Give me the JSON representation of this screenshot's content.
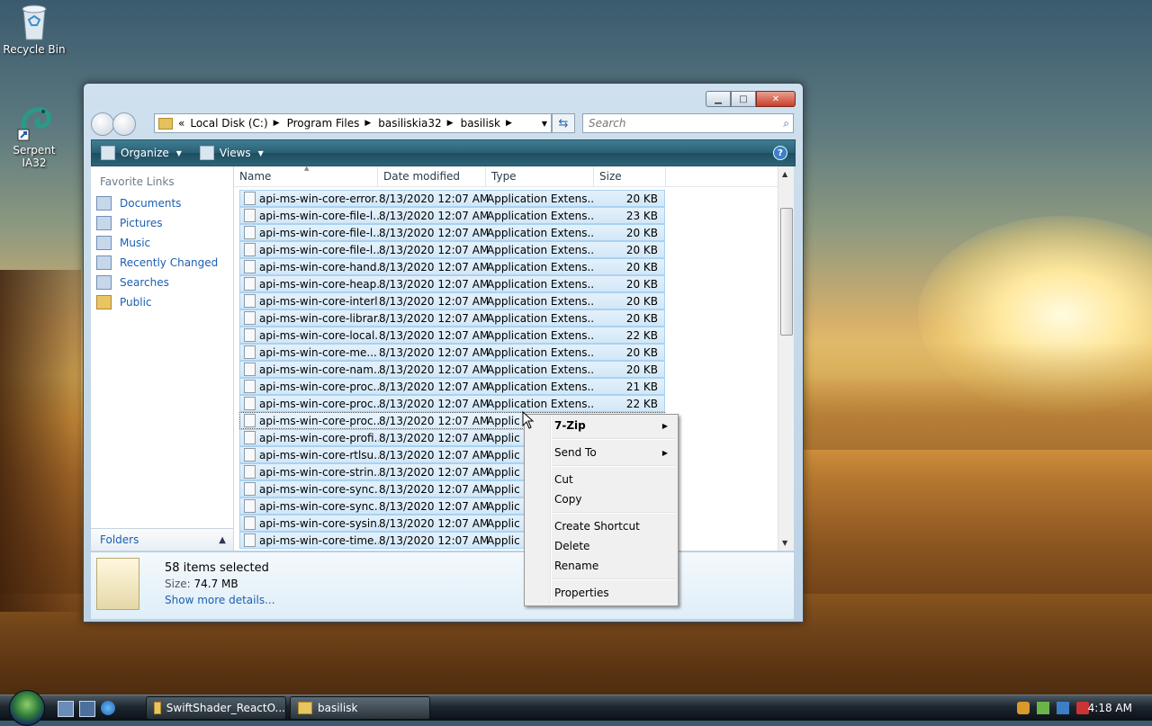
{
  "desktop": {
    "icons": [
      {
        "label": "Recycle Bin"
      },
      {
        "label": "Serpent IA32"
      }
    ]
  },
  "window": {
    "caption": {
      "minimize": "",
      "maximize": "",
      "close": ""
    },
    "address": {
      "prefix": "«",
      "crumbs": [
        "Local Disk (C:)",
        "Program Files",
        "basiliskia32",
        "basilisk"
      ]
    },
    "search": {
      "placeholder": "Search"
    },
    "toolbar": {
      "organize": "Organize",
      "views": "Views",
      "help": "?"
    },
    "nav": {
      "favorites_title": "Favorite Links",
      "links": [
        {
          "label": "Documents",
          "icon": "documents-icon"
        },
        {
          "label": "Pictures",
          "icon": "pictures-icon"
        },
        {
          "label": "Music",
          "icon": "music-icon"
        },
        {
          "label": "Recently Changed",
          "icon": "recently-changed-icon"
        },
        {
          "label": "Searches",
          "icon": "searches-icon"
        },
        {
          "label": "Public",
          "icon": "folder-icon"
        }
      ],
      "folders_label": "Folders"
    },
    "columns": {
      "name": "Name",
      "date": "Date modified",
      "type": "Type",
      "size": "Size"
    },
    "files": [
      {
        "name": "api-ms-win-core-error...",
        "date": "8/13/2020 12:07 AM",
        "type": "Application Extens...",
        "size": "20 KB"
      },
      {
        "name": "api-ms-win-core-file-l...",
        "date": "8/13/2020 12:07 AM",
        "type": "Application Extens...",
        "size": "23 KB"
      },
      {
        "name": "api-ms-win-core-file-l...",
        "date": "8/13/2020 12:07 AM",
        "type": "Application Extens...",
        "size": "20 KB"
      },
      {
        "name": "api-ms-win-core-file-l...",
        "date": "8/13/2020 12:07 AM",
        "type": "Application Extens...",
        "size": "20 KB"
      },
      {
        "name": "api-ms-win-core-hand...",
        "date": "8/13/2020 12:07 AM",
        "type": "Application Extens...",
        "size": "20 KB"
      },
      {
        "name": "api-ms-win-core-heap...",
        "date": "8/13/2020 12:07 AM",
        "type": "Application Extens...",
        "size": "20 KB"
      },
      {
        "name": "api-ms-win-core-interl...",
        "date": "8/13/2020 12:07 AM",
        "type": "Application Extens...",
        "size": "20 KB"
      },
      {
        "name": "api-ms-win-core-librar...",
        "date": "8/13/2020 12:07 AM",
        "type": "Application Extens...",
        "size": "20 KB"
      },
      {
        "name": "api-ms-win-core-local...",
        "date": "8/13/2020 12:07 AM",
        "type": "Application Extens...",
        "size": "22 KB"
      },
      {
        "name": "api-ms-win-core-me...",
        "date": "8/13/2020 12:07 AM",
        "type": "Application Extens...",
        "size": "20 KB"
      },
      {
        "name": "api-ms-win-core-nam...",
        "date": "8/13/2020 12:07 AM",
        "type": "Application Extens...",
        "size": "20 KB"
      },
      {
        "name": "api-ms-win-core-proc...",
        "date": "8/13/2020 12:07 AM",
        "type": "Application Extens...",
        "size": "21 KB"
      },
      {
        "name": "api-ms-win-core-proc...",
        "date": "8/13/2020 12:07 AM",
        "type": "Application Extens...",
        "size": "22 KB"
      },
      {
        "name": "api-ms-win-core-proc...",
        "date": "8/13/2020 12:07 AM",
        "type": "Applic",
        "size": ""
      },
      {
        "name": "api-ms-win-core-profi...",
        "date": "8/13/2020 12:07 AM",
        "type": "Applic",
        "size": ""
      },
      {
        "name": "api-ms-win-core-rtlsu...",
        "date": "8/13/2020 12:07 AM",
        "type": "Applic",
        "size": ""
      },
      {
        "name": "api-ms-win-core-strin...",
        "date": "8/13/2020 12:07 AM",
        "type": "Applic",
        "size": ""
      },
      {
        "name": "api-ms-win-core-sync...",
        "date": "8/13/2020 12:07 AM",
        "type": "Applic",
        "size": ""
      },
      {
        "name": "api-ms-win-core-sync...",
        "date": "8/13/2020 12:07 AM",
        "type": "Applic",
        "size": ""
      },
      {
        "name": "api-ms-win-core-sysin...",
        "date": "8/13/2020 12:07 AM",
        "type": "Applic",
        "size": ""
      },
      {
        "name": "api-ms-win-core-time...",
        "date": "8/13/2020 12:07 AM",
        "type": "Applic",
        "size": ""
      }
    ],
    "details": {
      "selected": "58 items selected",
      "size_label": "Size:",
      "size_value": "74.7 MB",
      "more": "Show more details..."
    }
  },
  "context_menu": {
    "items": [
      {
        "label": "7-Zip",
        "submenu": true,
        "bold": true
      },
      {
        "label": "Send To",
        "submenu": true
      },
      {
        "label": "Cut"
      },
      {
        "label": "Copy"
      },
      {
        "label": "Create Shortcut"
      },
      {
        "label": "Delete"
      },
      {
        "label": "Rename"
      },
      {
        "label": "Properties"
      }
    ]
  },
  "taskbar": {
    "tasks": [
      {
        "label": "SwiftShader_ReactO..."
      },
      {
        "label": "basilisk"
      }
    ],
    "clock": "4:18 AM"
  }
}
